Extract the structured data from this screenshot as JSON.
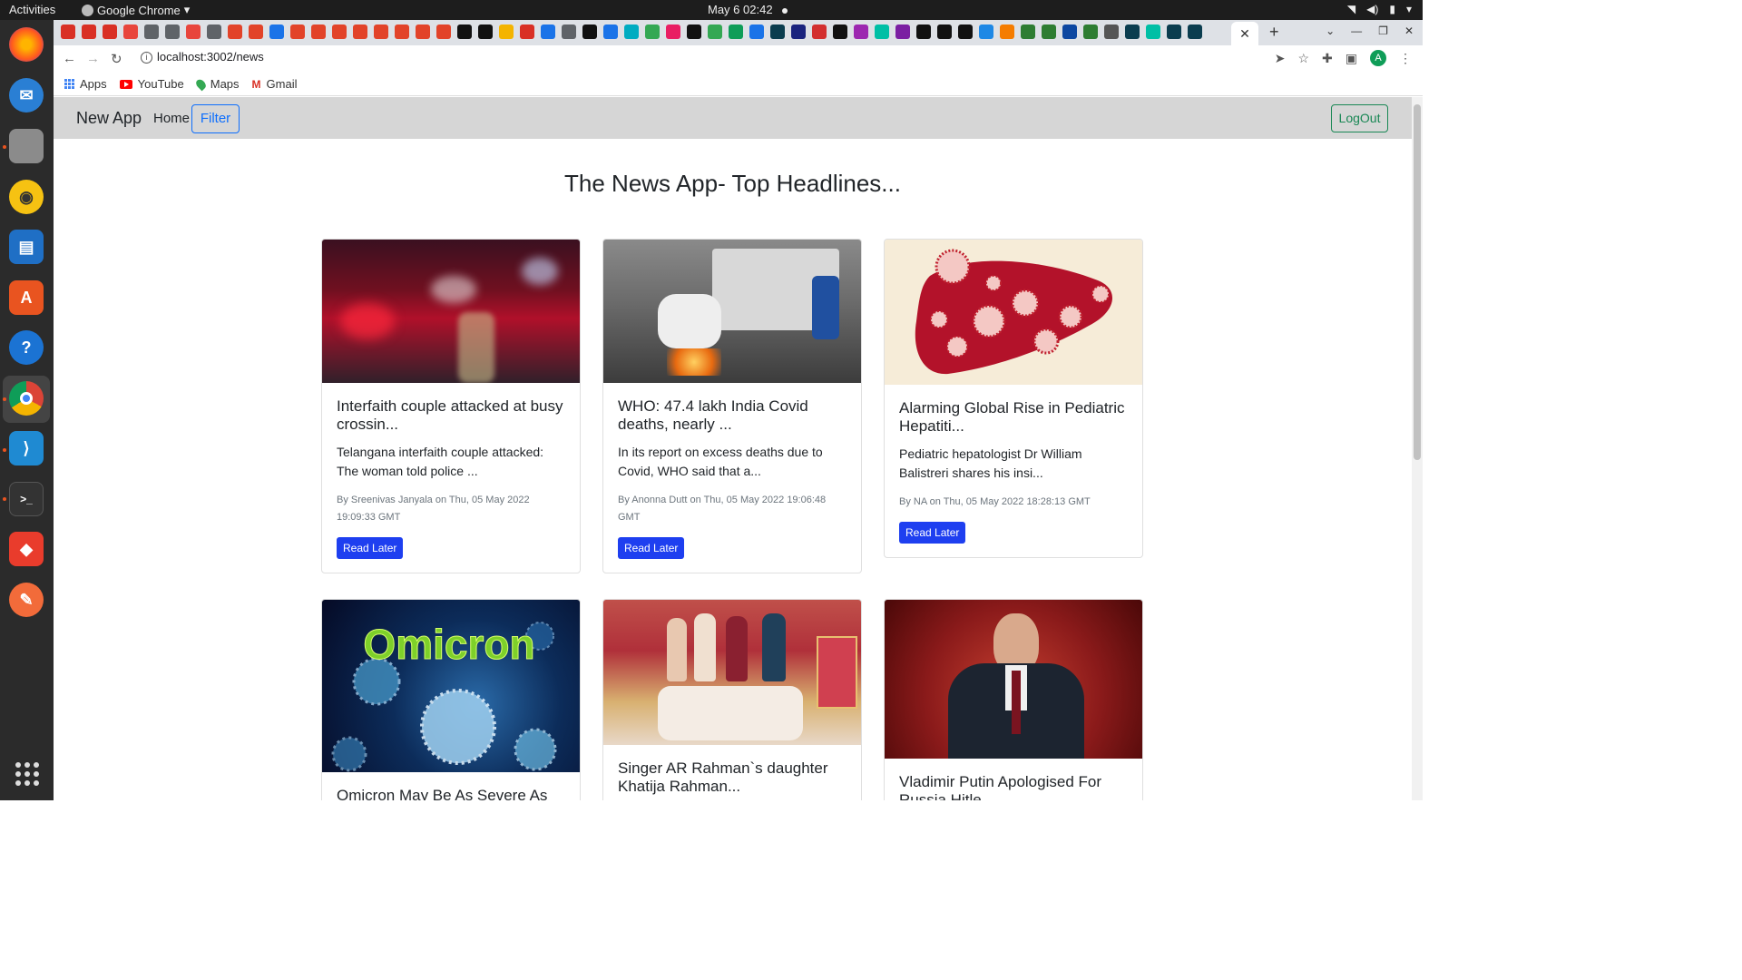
{
  "os": {
    "activities": "Activities",
    "app_name": "Google Chrome",
    "clock": "May 6  02:42"
  },
  "browser": {
    "url": "localhost:3002/news",
    "bookmarks": [
      {
        "label": "Apps"
      },
      {
        "label": "YouTube"
      },
      {
        "label": "Maps"
      },
      {
        "label": "Gmail"
      }
    ],
    "avatar_letter": "A"
  },
  "navbar": {
    "brand": "New App",
    "home": "Home",
    "filter": "Filter",
    "logout": "LogOut"
  },
  "page": {
    "title": "The News App- Top Headlines..."
  },
  "articles": [
    {
      "title": "Interfaith couple attacked at busy crossin...",
      "description": "Telangana interfaith couple attacked: The woman told police ...",
      "meta": "By Sreenivas Janyala on Thu, 05 May 2022 19:09:33 GMT",
      "button": "Read Later"
    },
    {
      "title": "WHO: 47.4 lakh India Covid deaths, nearly ...",
      "description": "In its report on excess deaths due to Covid, WHO said that a...",
      "meta": "By Anonna Dutt on Thu, 05 May 2022 19:06:48 GMT",
      "button": "Read Later"
    },
    {
      "title": "Alarming Global Rise in Pediatric Hepatiti...",
      "description": "Pediatric hepatologist Dr William Balistreri shares his insi...",
      "meta": "By NA on Thu, 05 May 2022 18:28:13 GMT",
      "button": "Read Later"
    },
    {
      "title": "Omicron May Be As Severe As",
      "image_text": "Omicron"
    },
    {
      "title": "Singer AR Rahman`s daughter Khatija Rahman..."
    },
    {
      "title": "Vladimir Putin Apologised For Russia Hitle"
    }
  ]
}
